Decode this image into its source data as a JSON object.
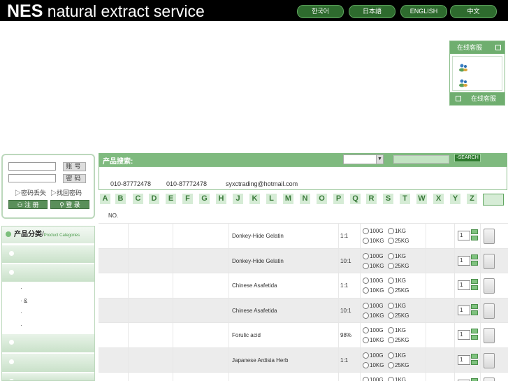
{
  "header": {
    "logo_bold": "NES",
    "logo_text": " natural extract service",
    "languages": [
      "한국어",
      "日本語",
      "ENGLISH",
      "中文"
    ]
  },
  "online_service": {
    "title": "在线客服",
    "footer": "在线客服",
    "contacts": [
      "qq-contact-1",
      "qq-contact-2"
    ]
  },
  "login": {
    "username_button": "账号",
    "password_button": "密码",
    "lost_password": "密码丢失",
    "retrieve_password": "找回密码",
    "register": "注 册",
    "signin": "登 录"
  },
  "categories": {
    "title": "产品分类",
    "sep": "/",
    "title_en": "Product Categories",
    "sub_items": [
      "·",
      "· &",
      "·",
      "·"
    ]
  },
  "search": {
    "label": "产品搜索:",
    "button": "SEARCH"
  },
  "contact": {
    "phone1": "010-87772478",
    "phone2": "010-87772478",
    "email": "syxctrading@hotmail.com"
  },
  "letters": [
    "A",
    "B",
    "C",
    "D",
    "E",
    "F",
    "G",
    "H",
    "J",
    "K",
    "L",
    "M",
    "N",
    "O",
    "P",
    "Q",
    "R",
    "S",
    "T",
    "W",
    "X",
    "Y",
    "Z"
  ],
  "table": {
    "header_no": "NO.",
    "size_options": [
      "100G",
      "1KG",
      "10KG",
      "25KG"
    ],
    "rows": [
      {
        "name": "Donkey-Hide Gelatin",
        "ratio": "1:1",
        "qty": "1"
      },
      {
        "name": "Donkey-Hide Gelatin",
        "ratio": "10:1",
        "qty": "1"
      },
      {
        "name": "Chinese Asafetida",
        "ratio": "1:1",
        "qty": "1"
      },
      {
        "name": "Chinese Asafetida",
        "ratio": "10:1",
        "qty": "1"
      },
      {
        "name": "Forulic acid",
        "ratio": "98%",
        "qty": "1"
      },
      {
        "name": "Japanese Ardisia Herb",
        "ratio": "1:1",
        "qty": "1"
      },
      {
        "name": "",
        "ratio": "",
        "qty": ""
      }
    ]
  }
}
